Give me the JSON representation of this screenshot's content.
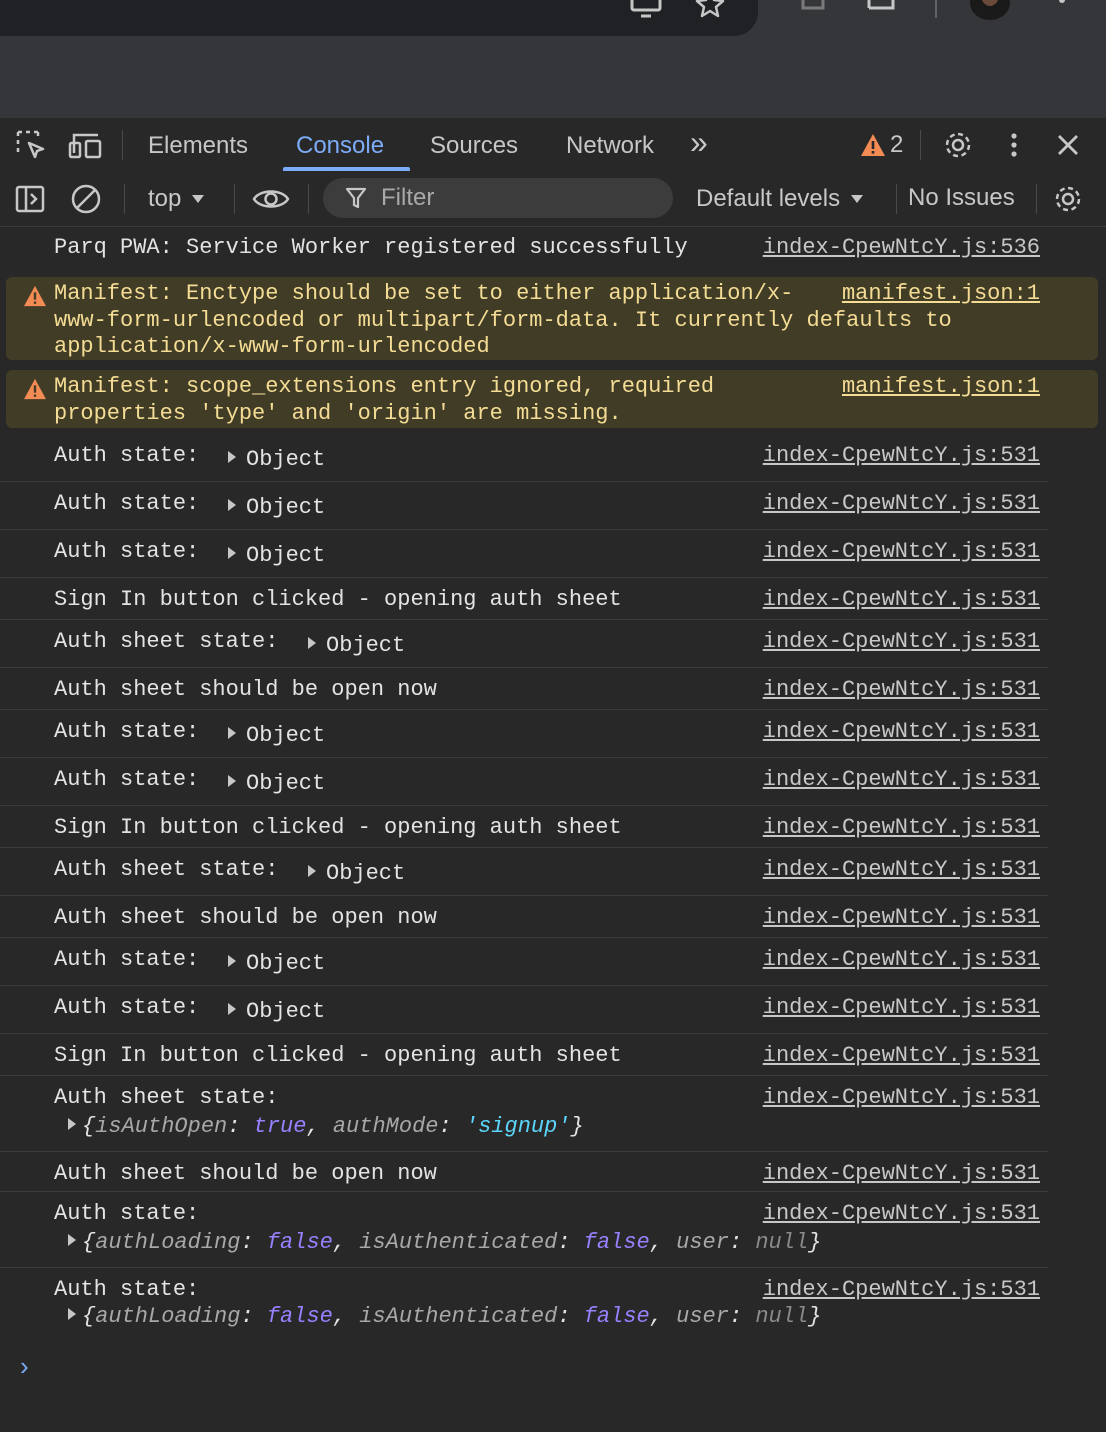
{
  "devtools": {
    "tabs": [
      "Elements",
      "Console",
      "Sources",
      "Network"
    ],
    "active_tab": "Console",
    "more_tabs_glyph": "»",
    "warning_count": "2"
  },
  "toolbar": {
    "context": "top",
    "filter_placeholder": "Filter",
    "levels": "Default levels",
    "issues": "No Issues"
  },
  "messages": {
    "m0": {
      "text": "Parq PWA: Service Worker registered successfully",
      "source": "index-CpewNtcY.js:536"
    },
    "w1": {
      "text": "Manifest: Enctype should be set to either application/x-\nwww-form-urlencoded or multipart/form-data. It currently defaults to\napplication/x-www-form-urlencoded",
      "source": "manifest.json:1"
    },
    "w2": {
      "text": "Manifest: scope_extensions entry ignored, required\nproperties 'type' and 'origin' are missing.",
      "source": "manifest.json:1"
    },
    "auth_state_label": "Auth state:",
    "auth_sheet_state_label": "Auth sheet state:",
    "object_label": "Object",
    "sign_in_text": "Sign In button clicked - opening auth sheet",
    "sheet_open_text": "Auth sheet should be open now",
    "source_531": "index-CpewNtcY.js:531",
    "sheet_obj": {
      "k1": "isAuthOpen",
      "v1": "true",
      "k2": "authMode",
      "v2": "'signup'"
    },
    "state_obj": {
      "k1": "authLoading",
      "v1": "false",
      "k2": "isAuthenticated",
      "v2": "false",
      "k3": "user",
      "v3": "null"
    }
  },
  "colors": {
    "accent": "#7cacf8",
    "warning_bg": "#413c26",
    "warning_text": "#f4dc95",
    "warning_icon": "#f28b54"
  }
}
